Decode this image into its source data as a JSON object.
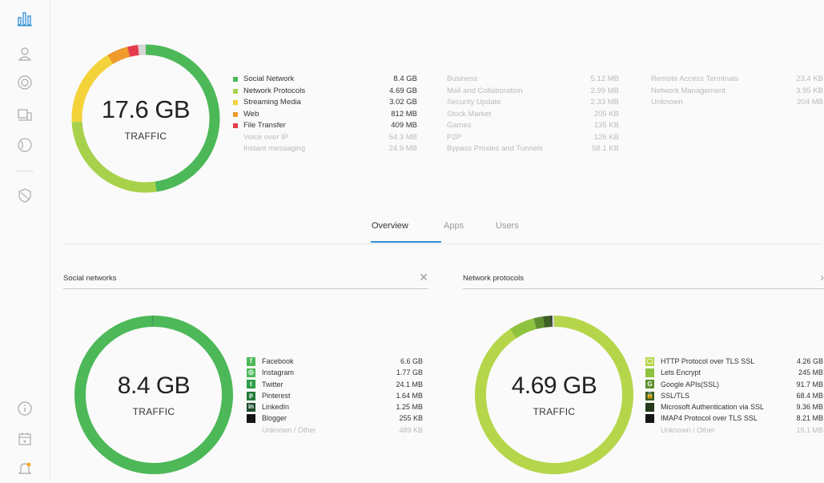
{
  "sidebar": {
    "icons": [
      "bar-chart-icon",
      "location-icon",
      "target-icon",
      "devices-icon",
      "globe-icon",
      "shield-icon",
      "info-icon",
      "calendar-icon",
      "notification-bell-icon"
    ],
    "accent": "#2d8fd5"
  },
  "summary": {
    "total": "17.6 GB",
    "total_label": "TRAFFIC",
    "colors": {
      "social": "#4cb858",
      "network": "#a8d14b",
      "streaming": "#f4d23a",
      "web": "#ef9a2a",
      "file": "#e63c4d",
      "other": "#d6d6d6"
    },
    "col1": [
      {
        "name": "Social Network",
        "value": "8.4 GB",
        "color": "#4cb858"
      },
      {
        "name": "Network Protocols",
        "value": "4.69 GB",
        "color": "#a8d14b"
      },
      {
        "name": "Streaming Media",
        "value": "3.02 GB",
        "color": "#f4d23a"
      },
      {
        "name": "Web",
        "value": "812 MB",
        "color": "#ef9a2a"
      },
      {
        "name": "File Transfer",
        "value": "409 MB",
        "color": "#e63c4d"
      },
      {
        "name": "Voice over IP",
        "value": "54.3 MB",
        "color": ""
      },
      {
        "name": "Instant messaging",
        "value": "24.9 MB",
        "color": ""
      }
    ],
    "col2": [
      {
        "name": "Business",
        "value": "5.12 MB"
      },
      {
        "name": "Mail and Collaboration",
        "value": "2.99 MB"
      },
      {
        "name": "Security Update",
        "value": "2.33 MB"
      },
      {
        "name": "Stock Market",
        "value": "205 KB"
      },
      {
        "name": "Games",
        "value": "135 KB"
      },
      {
        "name": "P2P",
        "value": "126 KB"
      },
      {
        "name": "Bypass Proxies and Tunnels",
        "value": "58.1 KB"
      }
    ],
    "col3": [
      {
        "name": "Remote Access Terminals",
        "value": "23.4 KB"
      },
      {
        "name": "Network Management",
        "value": "3.95 KB"
      },
      {
        "name": "Unknown",
        "value": "204 MB"
      }
    ]
  },
  "tabs": [
    "Overview",
    "Apps",
    "Users"
  ],
  "social": {
    "title": "Social networks",
    "close": "✕",
    "total": "8.4 GB",
    "total_label": "TRAFFIC",
    "items": [
      {
        "name": "Facebook",
        "value": "6.6 GB",
        "color": "#4cb858",
        "glyph": "f",
        "icon": "facebook-icon"
      },
      {
        "name": "Instagram",
        "value": "1.77 GB",
        "color": "#4cb858",
        "glyph": "◎",
        "icon": "instagram-icon"
      },
      {
        "name": "Twitter",
        "value": "24.1 MB",
        "color": "#2e9e48",
        "glyph": "t",
        "icon": "twitter-icon"
      },
      {
        "name": "Pinterest",
        "value": "1.64 MB",
        "color": "#217a3a",
        "glyph": "p",
        "icon": "pinterest-icon"
      },
      {
        "name": "LinkedIn",
        "value": "1.25 MB",
        "color": "#1d4d2b",
        "glyph": "in",
        "icon": "linkedin-icon"
      },
      {
        "name": "Blogger",
        "value": "255 KB",
        "color": "#151515",
        "glyph": "",
        "icon": "blogger-icon"
      },
      {
        "name": "Unknown / Other",
        "value": "489 KB",
        "color": "",
        "glyph": "",
        "icon": ""
      }
    ]
  },
  "network": {
    "title": "Network protocols",
    "close": "›",
    "total": "4.69 GB",
    "total_label": "TRAFFIC",
    "items": [
      {
        "name": "HTTP Protocol over TLS SSL",
        "value": "4.26 GB",
        "color": "#b5d64a",
        "glyph": "▢",
        "icon": "http-protocol-icon"
      },
      {
        "name": "Lets Encrypt",
        "value": "245 MB",
        "color": "#8fc23f",
        "glyph": "",
        "icon": "lets-encrypt-icon"
      },
      {
        "name": "Google APIs(SSL)",
        "value": "91.7 MB",
        "color": "#5f8f2f",
        "glyph": "G",
        "icon": "google-icon"
      },
      {
        "name": "SSL/TLS",
        "value": "68.4 MB",
        "color": "#3c5f22",
        "glyph": "🔒",
        "icon": "lock-icon"
      },
      {
        "name": "Microsoft Authentication via SSL",
        "value": "9.36 MB",
        "color": "#24381a",
        "glyph": "",
        "icon": "microsoft-icon"
      },
      {
        "name": "IMAP4 Protocol over TLS SSL",
        "value": "8.21 MB",
        "color": "#151515",
        "glyph": "",
        "icon": "imap-icon"
      },
      {
        "name": "Unknown / Other",
        "value": "19.1 MB",
        "color": "",
        "glyph": "",
        "icon": ""
      }
    ]
  }
}
